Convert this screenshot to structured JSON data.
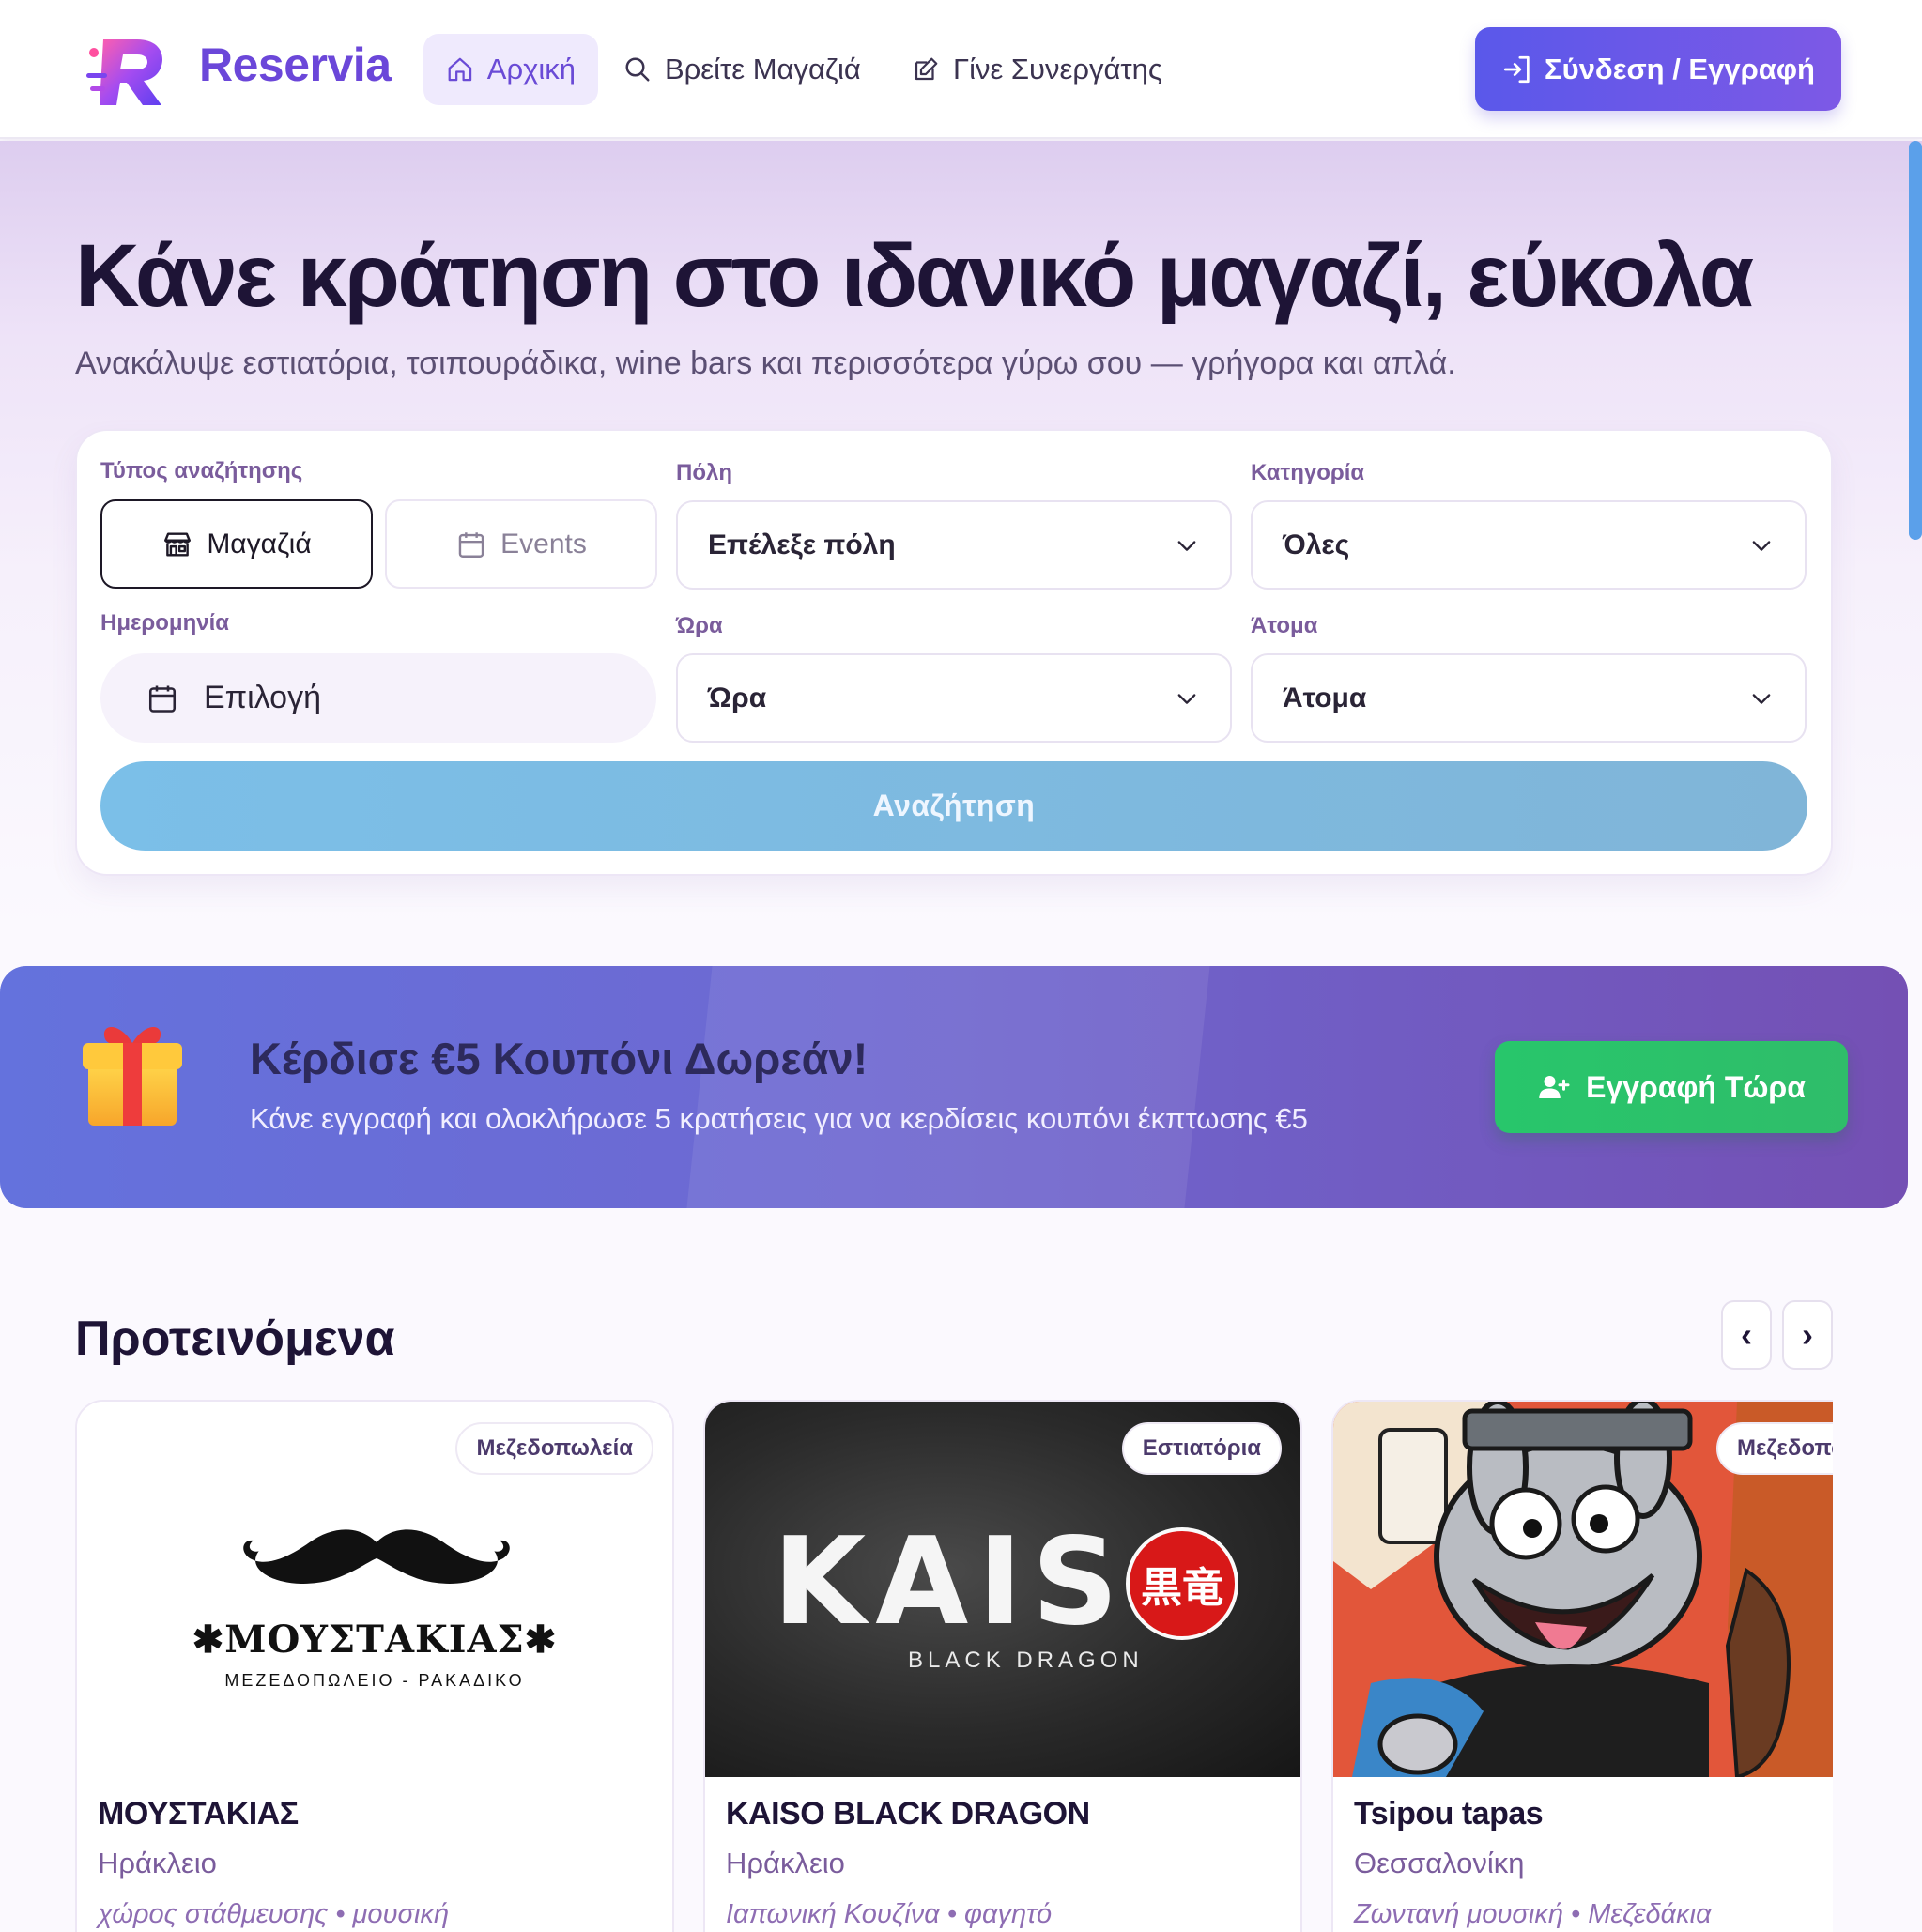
{
  "app": {
    "brand": "Reservia"
  },
  "nav": {
    "items": [
      {
        "label": "Αρχική",
        "icon": "home-icon",
        "active": true
      },
      {
        "label": "Βρείτε Μαγαζιά",
        "icon": "search-icon",
        "active": false
      },
      {
        "label": "Γίνε Συνεργάτης",
        "icon": "edit-icon",
        "active": false
      }
    ],
    "login_label": "Σύνδεση / Εγγραφή"
  },
  "hero": {
    "title": "Κάνε κράτηση στο ιδανικό μαγαζί, εύκολα",
    "subtitle": "Ανακάλυψε εστιατόρια, τσιπουράδικα, wine bars και περισσότερα γύρω σου — γρήγορα και απλά."
  },
  "search": {
    "type_label": "Τύπος αναζήτησης",
    "type_options": [
      {
        "label": "Μαγαζιά",
        "icon": "store-icon",
        "selected": true
      },
      {
        "label": "Events",
        "icon": "calendar-icon",
        "selected": false
      }
    ],
    "city_label": "Πόλη",
    "city_value": "Επέλεξε πόλη",
    "category_label": "Κατηγορία",
    "category_value": "Όλες",
    "date_label": "Ημερομηνία",
    "date_value": "Επιλογή",
    "time_label": "Ώρα",
    "time_value": "Ώρα",
    "people_label": "Άτομα",
    "people_value": "Άτομα",
    "submit_label": "Αναζήτηση"
  },
  "promo": {
    "title": "Κέρδισε €5 Κουπόνι Δωρεάν!",
    "subtitle": "Κάνε εγγραφή και ολοκλήρωσε 5 κρατήσεις για να κερδίσεις κουπόνι έκπτωσης €5",
    "button_label": "Εγγραφή Τώρα",
    "icon": "gift-icon"
  },
  "recommended": {
    "title": "Προτεινόμενα",
    "prev_label": "‹",
    "next_label": "›",
    "cards": [
      {
        "badge": "Μεζεδοπωλεία",
        "name": "ΜΟΥΣΤΑΚΙΑΣ",
        "city": "Ηράκλειο",
        "tags": "χώρος στάθμευσης • μουσική",
        "logo_title": "✱ΜΟΥΣΤΑΚΙΑΣ✱",
        "logo_sub": "ΜΕΖΕΔΟΠΩΛΕΙΟ - ΡΑΚΑΔΙΚΟ"
      },
      {
        "badge": "Εστιατόρια",
        "name": "KAISO BLACK DRAGON",
        "city": "Ηράκλειο",
        "tags": "Ιαπωνική Κουζίνα • φαγητό",
        "logo_title": "KAIS",
        "logo_kanji": "黒竜",
        "logo_sub": "BLACK DRAGON"
      },
      {
        "badge": "Μεζεδοπωλεία",
        "name": "Tsipou tapas",
        "city": "Θεσσαλονίκη",
        "tags": "Ζωντανή μουσική • Μεζεδάκια"
      }
    ]
  }
}
